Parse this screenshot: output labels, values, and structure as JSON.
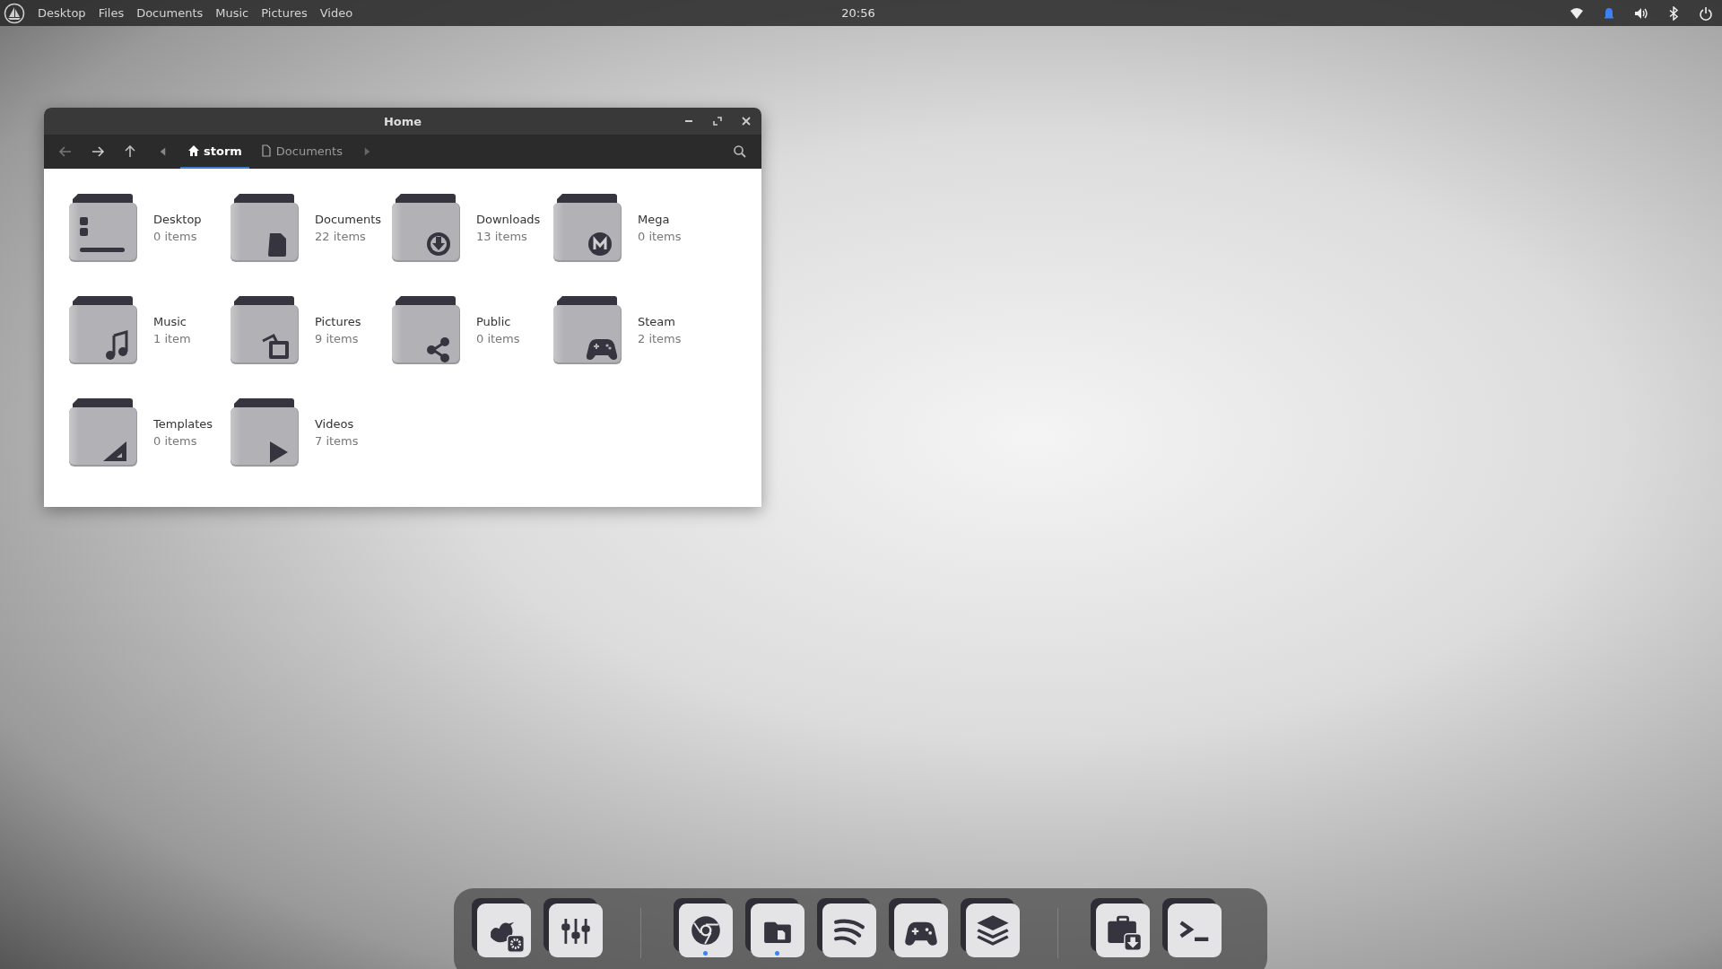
{
  "top_bar": {
    "menu": [
      "Desktop",
      "Files",
      "Documents",
      "Music",
      "Pictures",
      "Video"
    ],
    "clock": "20:56"
  },
  "window": {
    "title": "Home",
    "breadcrumbs": [
      {
        "label": "storm",
        "kind": "home",
        "selected": true
      },
      {
        "label": "Documents",
        "kind": "document",
        "selected": false
      }
    ],
    "folders": [
      {
        "name": "Desktop",
        "count": "0 items",
        "kind": "desktop"
      },
      {
        "name": "Documents",
        "count": "22 items",
        "kind": "document"
      },
      {
        "name": "Downloads",
        "count": "13 items",
        "kind": "download"
      },
      {
        "name": "Mega",
        "count": "0 items",
        "kind": "mega"
      },
      {
        "name": "Music",
        "count": "1 item",
        "kind": "music"
      },
      {
        "name": "Pictures",
        "count": "9 items",
        "kind": "pictures"
      },
      {
        "name": "Public",
        "count": "0 items",
        "kind": "share"
      },
      {
        "name": "Steam",
        "count": "2 items",
        "kind": "gamepad"
      },
      {
        "name": "Templates",
        "count": "0 items",
        "kind": "ruler"
      },
      {
        "name": "Videos",
        "count": "7 items",
        "kind": "play"
      }
    ]
  },
  "dock": {
    "groups": [
      [
        {
          "kind": "bird",
          "running": false
        },
        {
          "kind": "mixer",
          "running": false
        }
      ],
      [
        {
          "kind": "browser",
          "running": true
        },
        {
          "kind": "files",
          "running": true
        },
        {
          "kind": "stream",
          "running": false
        },
        {
          "kind": "gamepad",
          "running": false
        },
        {
          "kind": "layers",
          "running": false
        }
      ],
      [
        {
          "kind": "briefcase",
          "running": false
        },
        {
          "kind": "terminal",
          "running": false
        }
      ]
    ]
  }
}
